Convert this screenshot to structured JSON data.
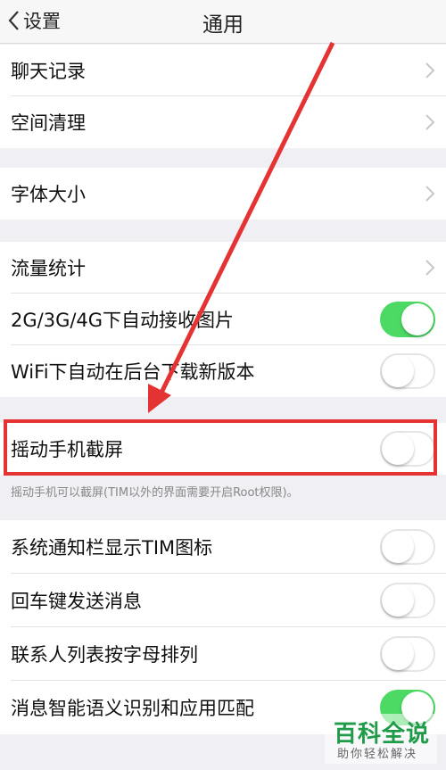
{
  "nav": {
    "back_label": "设置",
    "title": "通用"
  },
  "groups": [
    {
      "items": [
        {
          "label": "聊天记录"
        },
        {
          "label": "空间清理"
        }
      ]
    },
    {
      "items": [
        {
          "label": "字体大小"
        }
      ]
    },
    {
      "items": [
        {
          "label": "流量统计"
        },
        {
          "label": "2G/3G/4G下自动接收图片",
          "toggle": true
        },
        {
          "label": "WiFi下自动在后台下载新版本",
          "toggle": false
        }
      ]
    },
    {
      "items": [
        {
          "label": "摇动手机截屏",
          "toggle": false
        }
      ]
    },
    {
      "items": [
        {
          "label": "系统通知栏显示TIM图标",
          "toggle": false
        },
        {
          "label": "回车键发送消息",
          "toggle": false
        },
        {
          "label": "联系人列表按字母排列",
          "toggle": false
        },
        {
          "label": "消息智能语义识别和应用匹配",
          "toggle": true
        }
      ]
    }
  ],
  "shake_note": "摇动手机可以截屏(TIM以外的界面需要开启Root权限)。",
  "watermark": {
    "title": "百科全说",
    "subtitle": "助你轻松解决"
  },
  "colors": {
    "toggle_on": "#4cd964",
    "annotation": "#e53333",
    "watermark": "#1f9b4a"
  }
}
